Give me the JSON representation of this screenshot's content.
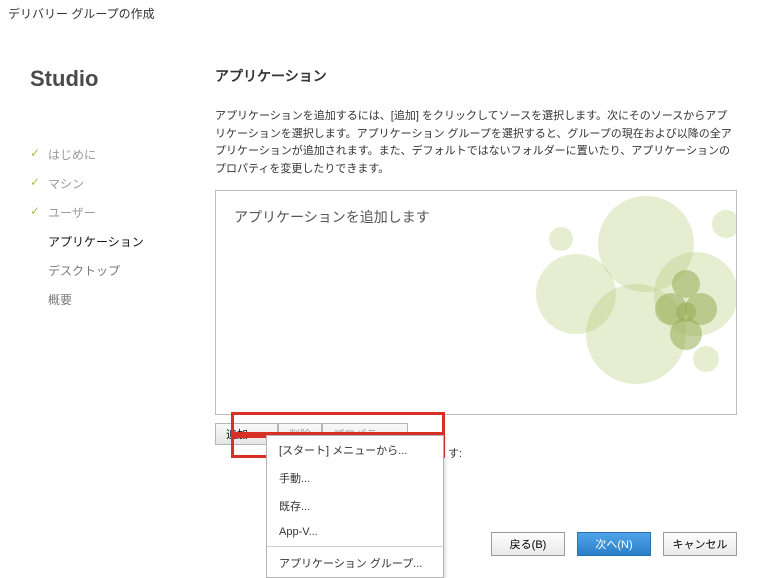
{
  "window": {
    "title": "デリバリー グループの作成"
  },
  "sidebar": {
    "brand": "Studio",
    "steps": [
      {
        "label": "はじめに"
      },
      {
        "label": "マシン"
      },
      {
        "label": "ユーザー"
      },
      {
        "label": "アプリケーション"
      },
      {
        "label": "デスクトップ"
      },
      {
        "label": "概要"
      }
    ]
  },
  "main": {
    "title": "アプリケーション",
    "description": "アプリケーションを追加するには、[追加] をクリックしてソースを選択します。次にそのソースからアプリケーションを選択します。アプリケーション グループを選択すると、グループの現在および以降の全アプリケーションが追加されます。また、デフォルトではないフォルダーに置いたり、アプリケーションのプロパティを変更したりできます。",
    "box_text": "アプリケーションを追加します",
    "toolbar": {
      "add": "追加...",
      "remove": "削除",
      "properties": "プロパティ..."
    },
    "menu": {
      "start_menu": "[スタート] メニューから...",
      "manual": "手動...",
      "existing": "既存...",
      "appv": "App-V...",
      "group": "アプリケーション グループ..."
    },
    "folder_suffix": "す:"
  },
  "footer": {
    "back": "戻る(B)",
    "next": "次へ(N)",
    "cancel": "キャンセル"
  }
}
